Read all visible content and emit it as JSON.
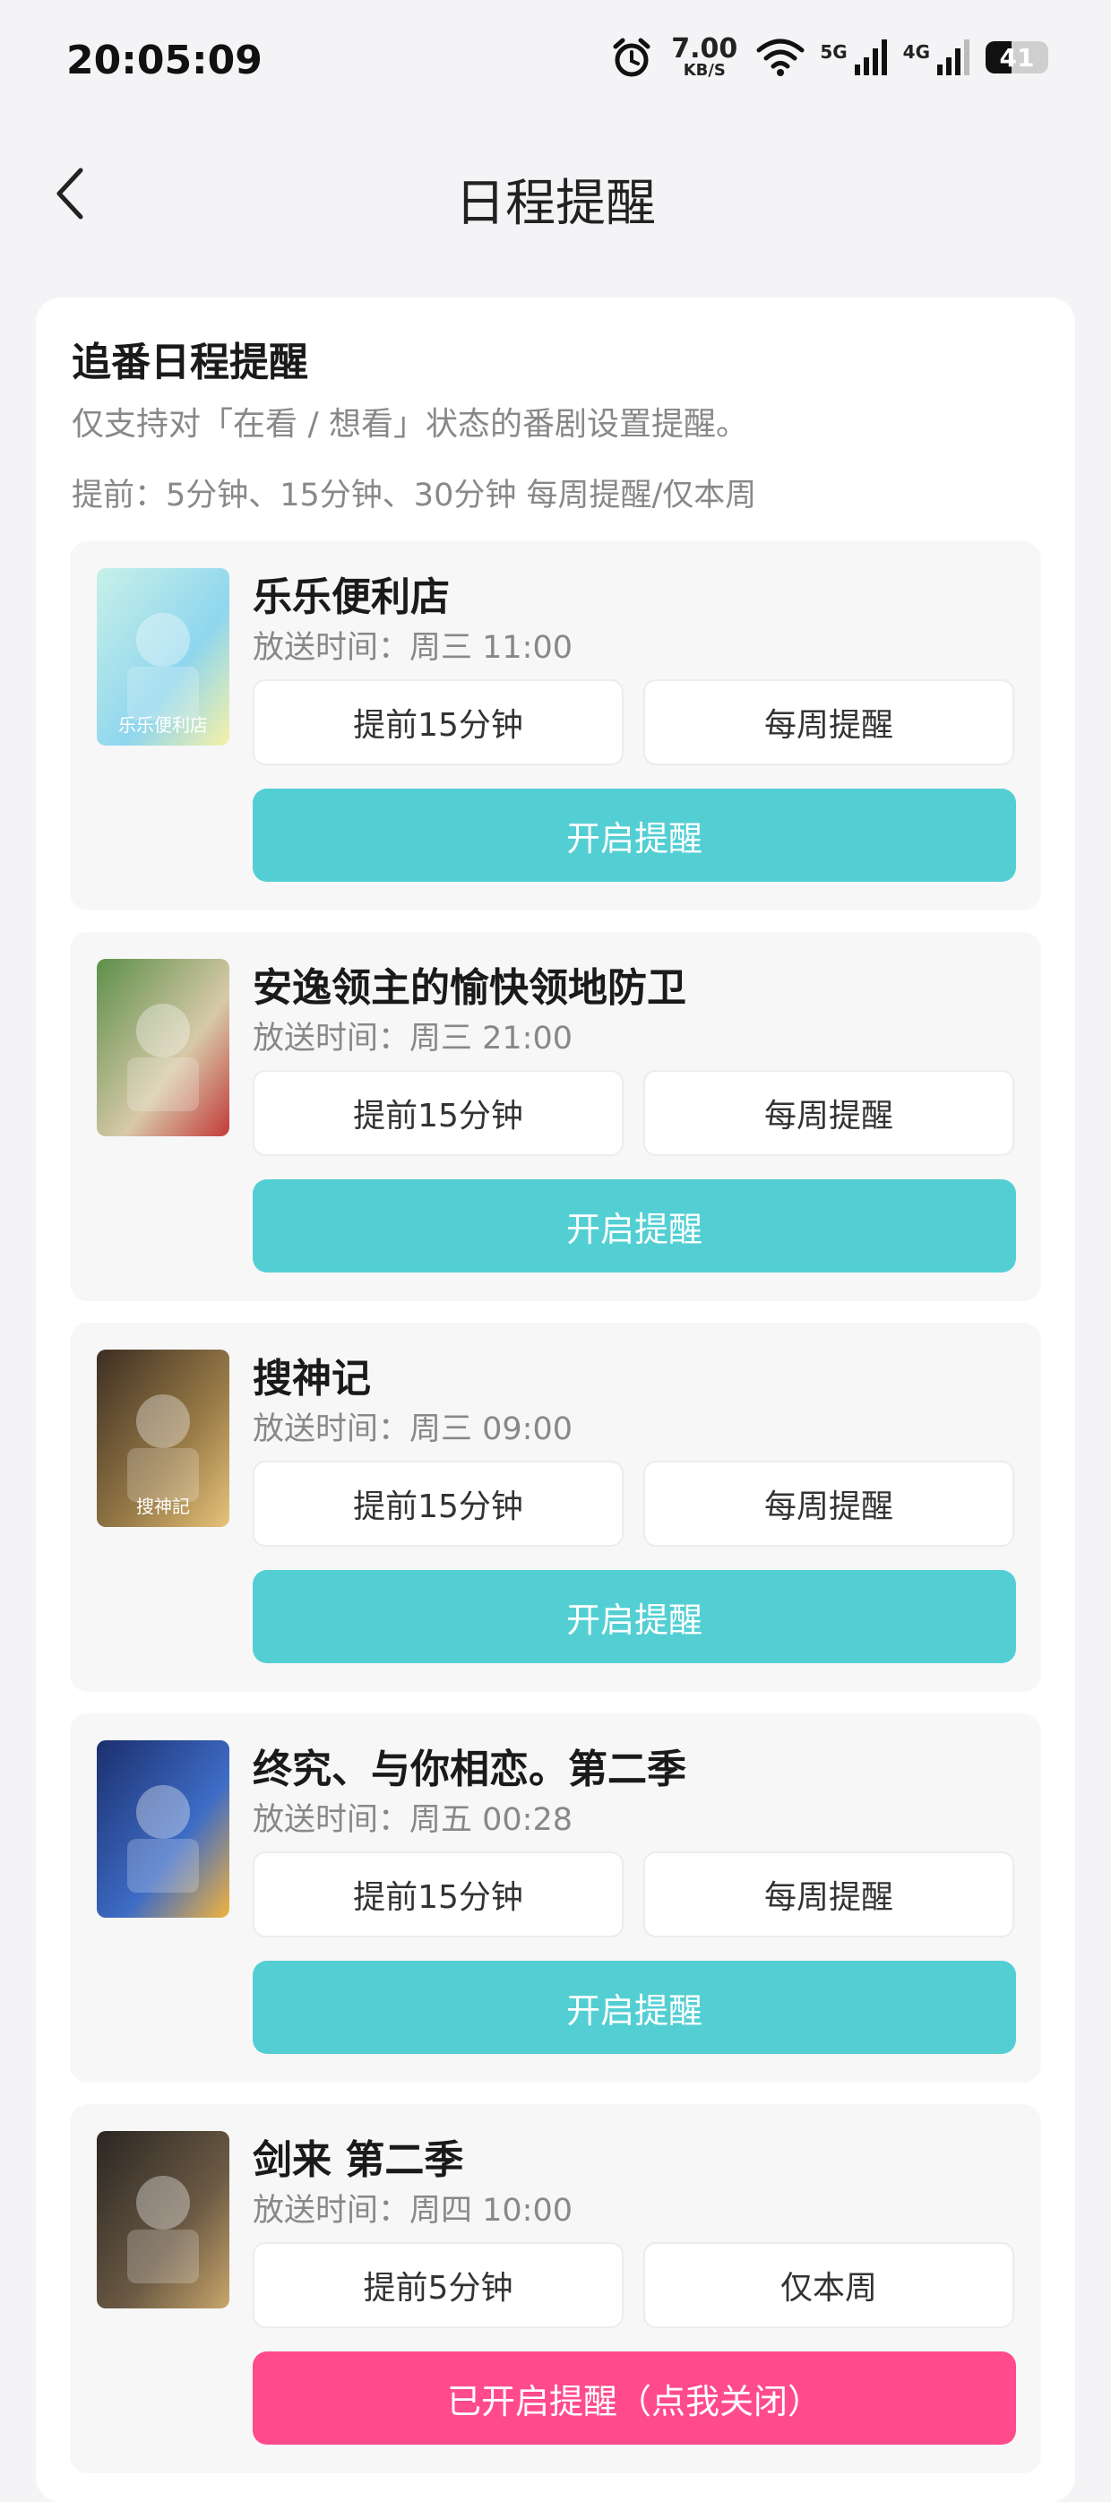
{
  "status_bar": {
    "time": "20:05:09",
    "net_speed_value": "7.00",
    "net_speed_unit": "KB/S",
    "signal1_label": "5G",
    "signal2_label": "4G",
    "battery_level": "41",
    "icons": [
      "alarm-icon",
      "wifi-icon",
      "signal-icon",
      "battery-icon"
    ]
  },
  "nav": {
    "title": "日程提醒",
    "back_icon": "chevron-left-icon"
  },
  "panel": {
    "title": "追番日程提醒",
    "subtitle": "仅支持对「在看 / 想看」状态的番剧设置提醒。",
    "note": "提前：5分钟、15分钟、30分钟 每周提醒/仅本周"
  },
  "shows": [
    {
      "name": "乐乐便利店",
      "airtime": "放送时间：周三 11:00",
      "advance": "提前15分钟",
      "repeat": "每周提醒",
      "action": "开启提醒",
      "enabled": false,
      "cover_colors": [
        "#c8f0e8",
        "#8fd6ee",
        "#f6f1a8"
      ],
      "cover_text": "乐乐便利店"
    },
    {
      "name": "安逸领主的愉快领地防卫",
      "airtime": "放送时间：周三 21:00",
      "advance": "提前15分钟",
      "repeat": "每周提醒",
      "action": "开启提醒",
      "enabled": false,
      "cover_colors": [
        "#5d8f4a",
        "#d7c9a8",
        "#c23a3a"
      ],
      "cover_text": ""
    },
    {
      "name": "搜神记",
      "airtime": "放送时间：周三 09:00",
      "advance": "提前15分钟",
      "repeat": "每周提醒",
      "action": "开启提醒",
      "enabled": false,
      "cover_colors": [
        "#3c2e22",
        "#9a7c48",
        "#e7c37a"
      ],
      "cover_text": "搜神記"
    },
    {
      "name": "终究、与你相恋。第二季",
      "airtime": "放送时间：周五 00:28",
      "advance": "提前15分钟",
      "repeat": "每周提醒",
      "action": "开启提醒",
      "enabled": false,
      "cover_colors": [
        "#1b2f6d",
        "#3e6cc6",
        "#f1b23d"
      ],
      "cover_text": ""
    },
    {
      "name": "剑来 第二季",
      "airtime": "放送时间：周四 10:00",
      "advance": "提前5分钟",
      "repeat": "仅本周",
      "action": "已开启提醒（点我关闭）",
      "enabled": true,
      "cover_colors": [
        "#2a2622",
        "#6b5a44",
        "#c9a66b"
      ],
      "cover_text": ""
    }
  ],
  "colors": {
    "action_off": "#53cfd3",
    "action_on": "#ff4b8b"
  }
}
